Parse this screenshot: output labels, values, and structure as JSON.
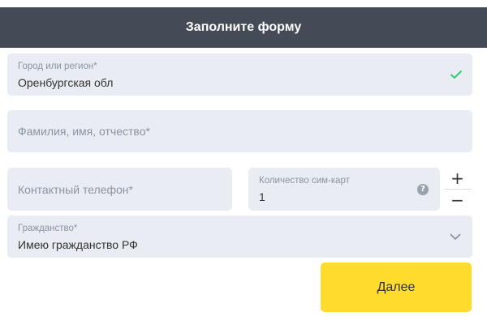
{
  "header": {
    "title": "Заполните форму"
  },
  "form": {
    "city": {
      "label": "Город или регион*",
      "value": "Оренбургская обл",
      "status_icon": "check-icon"
    },
    "fio": {
      "placeholder": "Фамилия, имя, отчество*"
    },
    "phone": {
      "placeholder": "Контактный телефон*"
    },
    "sim_count": {
      "label": "Количество сим-карт",
      "value": "1",
      "help_icon": "question-icon"
    },
    "stepper": {
      "plus": "+",
      "minus": "−"
    },
    "citizenship": {
      "label": "Гражданство*",
      "value": "Имею гражданство РФ",
      "icon": "chevron-down-icon"
    },
    "next_label": "Далее"
  },
  "colors": {
    "header_bg": "#444b57",
    "field_bg": "#e9edf3",
    "accent_yellow": "#fddc2e",
    "check_green": "#2ecc71"
  }
}
